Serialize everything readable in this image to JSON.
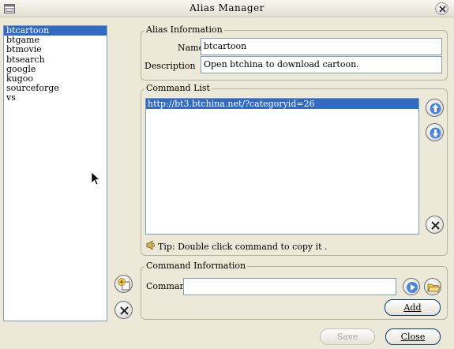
{
  "window": {
    "title": "Alias Manager"
  },
  "aliases": [
    "btcartoon",
    "btgame",
    "btmovie",
    "btsearch",
    "google",
    "kugoo",
    "sourceforge",
    "vs"
  ],
  "selected_alias": "btcartoon",
  "alias_info": {
    "legend": "Alias Information",
    "name_label": "Name",
    "name_value": "btcartoon",
    "description_label": "Description",
    "description_value": "Open btchina to download cartoon."
  },
  "command_list": {
    "legend": "Command List",
    "items": [
      "http://bt3.btchina.net/?categoryid=26"
    ],
    "tip": "Tip: Double click command to copy it ."
  },
  "command_info": {
    "legend": "Command Information",
    "command_label": "Command",
    "command_value": "",
    "add_label": "Add"
  },
  "footer": {
    "save_label": "Save",
    "close_label": "Close"
  },
  "colors": {
    "selection": "#316ac5",
    "dialog_bg": "#ece9d8",
    "field_border": "#7f9db9"
  }
}
